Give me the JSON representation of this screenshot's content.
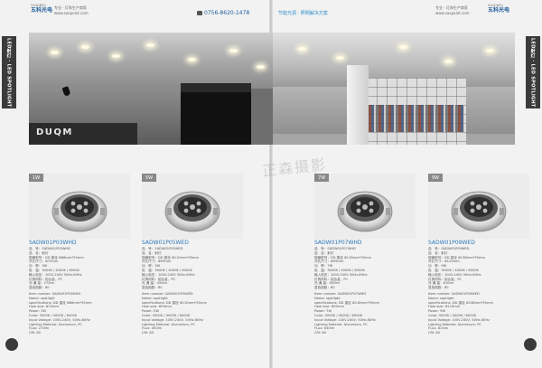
{
  "header": {
    "brand_cn": "五科光电",
    "brand_en": "SAXONPU",
    "slogan": "专业 · 灯饰生产商家",
    "website_small": "www.saxpoint.com",
    "phone": "0756-8620-1478",
    "website": "节能光源 · 照明解决方案"
  },
  "side_tab": {
    "label": "LED射灯 · LED SPOTLIGHT"
  },
  "banner": {
    "logo": "DUQM"
  },
  "watermark": "正森摄影",
  "products": [
    {
      "wattage": "1W",
      "model": "SADW01P03WHD",
      "spec_cn": [
        "品　号：SADW01P03WHD",
        "品　名：射灯",
        "规格型号：DD 直径 Φ86mm*55mm",
        "开孔尺寸：Φ70mm",
        "功　率：3W",
        "色　温：3000K / 4000K / 6000K",
        "输入电压：100V-240V 50Hz-60Hz",
        "灯具材料：铝合金，PC",
        "光 通 量：270lm",
        "显色指数：80"
      ],
      "spec_en": [
        "Item number: SADW01P03WHD",
        "Name: spotlight",
        "specifications: DD 直径 Φ86mm*55mm",
        "Hole size: Φ70mm",
        "Power: 3W",
        "Color: 3000K / 4000K / 6000K",
        "Input Voltage: 100V-240V, 50Hz-60Hz",
        "Lighting Material: Aluminium, PC",
        "FLux: 270lm",
        "CRI: 80"
      ]
    },
    {
      "wattage": "5W",
      "model": "SADW01P05WED",
      "spec_cn": [
        "品　号：SADW01P05WED",
        "品　名：射灯",
        "规格型号：DD 直径 Φ110mm*55mm",
        "开孔尺寸：Φ95mm",
        "功　率：5W",
        "色　温：3000K / 4000K / 6000K",
        "输入电压：100V-240V 50Hz-60Hz",
        "灯具材料：铝合金，PC",
        "光 通 量：450lm",
        "显色指数：80"
      ],
      "spec_en": [
        "Item number: SADW01P05WED",
        "Name: spotlight",
        "specifications: DD 直径 Φ110mm*55mm",
        "Hole size: Φ95mm",
        "Power: 5W",
        "Color: 3000K / 4000K / 6000K",
        "Input Voltage: 100V-240V, 50Hz-60Hz",
        "Lighting Material: Aluminium, PC",
        "FLux: 450lm",
        "CRI: 80"
      ]
    },
    {
      "wattage": "7W",
      "model": "SADW01P07WHD",
      "spec_cn": [
        "品　号：SADW01P07WHD",
        "品　名：射灯",
        "规格型号：DD 直径 Φ118mm*55mm",
        "开孔尺寸：Φ95mm",
        "功　率：7W",
        "色　温：3000K / 4000K / 6000K",
        "输入电压：100V-240V 50Hz-60Hz",
        "灯具材料：铝合金，PC",
        "光 通 量：630lm",
        "显色指数：80"
      ],
      "spec_en": [
        "Item number: SADW01P07WHD",
        "Name: spotlight",
        "specifications: DD 直径 Φ118mm*55mm",
        "Hole size: Φ95mm",
        "Power: 7W",
        "Color: 3000K / 4000K / 6000K",
        "Input Voltage: 100V-240V, 50Hz-60Hz",
        "Lighting Material: Aluminium, PC",
        "FLux: 630lm",
        "CRI: 80"
      ]
    },
    {
      "wattage": "9W",
      "model": "SADW01P09WED",
      "spec_cn": [
        "品　号：SADW01P09WED",
        "品　名：射灯",
        "规格型号：DD 直径 Φ138mm*55mm",
        "开孔尺寸：Φ110mm",
        "功　率：9W",
        "色　温：3000K / 4000K / 6000K",
        "输入电压：100V-240V 50Hz-60Hz",
        "灯具材料：铝合金，PC",
        "光 通 量：810lm",
        "显色指数：80"
      ],
      "spec_en": [
        "Item number: SADW01P09WED",
        "Name: spotlight",
        "specifications: DD 直径 Φ138mm*55mm",
        "Hole size: Φ110mm",
        "Power: 9W",
        "Color: 3000K / 4000K / 6000K",
        "Input Voltage: 100V-240V, 50Hz-60Hz",
        "Lighting Material: Aluminium, PC",
        "FLux: 810lm",
        "CRI: 80"
      ]
    }
  ]
}
